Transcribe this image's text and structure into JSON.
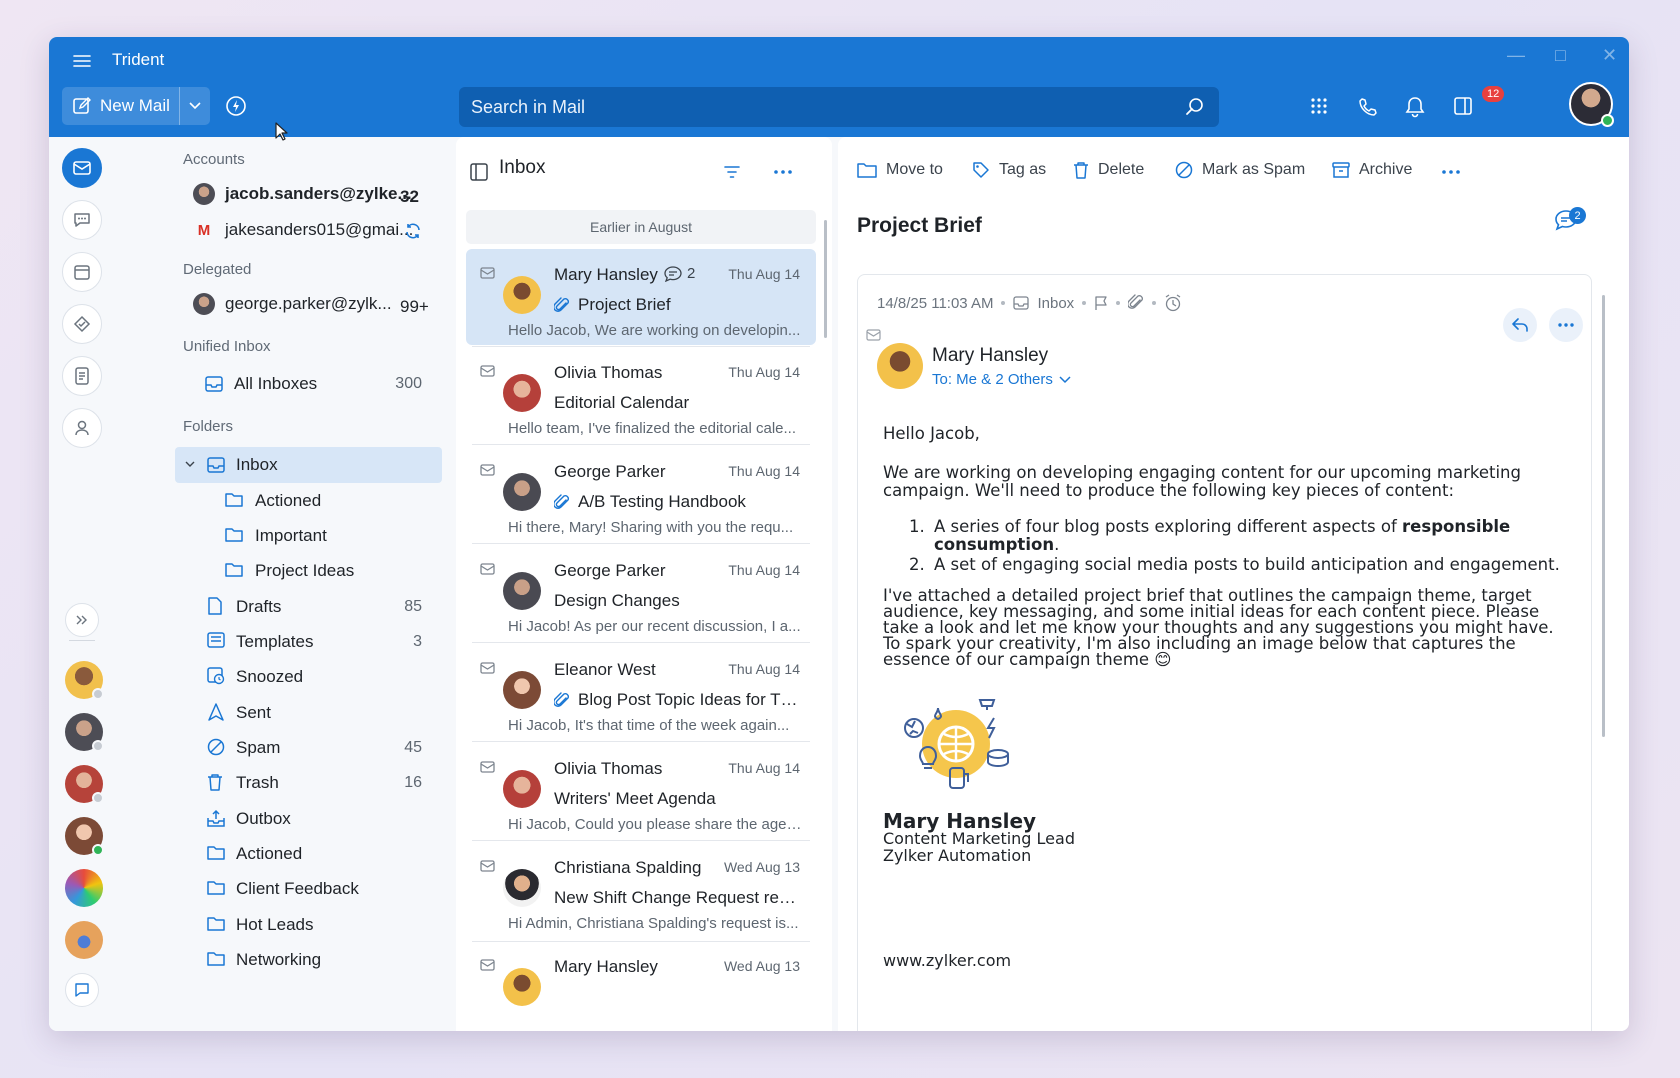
{
  "window": {
    "title": "Trident"
  },
  "header": {
    "new_mail_label": "New Mail",
    "search_placeholder": "Search in Mail",
    "notification_count": "12"
  },
  "rail": {
    "icons": [
      "mail-icon",
      "chat-icon",
      "calendar-icon",
      "tasks-icon",
      "notes-icon",
      "contacts-icon"
    ]
  },
  "folders_pane": {
    "accounts_header": "Accounts",
    "accounts": [
      {
        "name": "jacob.sanders@zylke...",
        "count": "32"
      },
      {
        "name": "jakesanders015@gmai..."
      }
    ],
    "delegated_header": "Delegated",
    "delegated": [
      {
        "name": "george.parker@zylk...",
        "count": "99+"
      }
    ],
    "unified_header": "Unified Inbox",
    "unified": {
      "label": "All Inboxes",
      "count": "300"
    },
    "folders_header": "Folders",
    "folders": [
      {
        "label": "Inbox",
        "count": ""
      },
      {
        "label": "Actioned",
        "count": ""
      },
      {
        "label": "Important",
        "count": ""
      },
      {
        "label": "Project Ideas",
        "count": ""
      },
      {
        "label": "Drafts",
        "count": "85"
      },
      {
        "label": "Templates",
        "count": "3"
      },
      {
        "label": "Snoozed",
        "count": ""
      },
      {
        "label": "Sent",
        "count": ""
      },
      {
        "label": "Spam",
        "count": "45"
      },
      {
        "label": "Trash",
        "count": "16"
      },
      {
        "label": "Outbox",
        "count": ""
      },
      {
        "label": "Actioned",
        "count": ""
      },
      {
        "label": "Client Feedback",
        "count": ""
      },
      {
        "label": "Hot Leads",
        "count": ""
      },
      {
        "label": "Networking",
        "count": ""
      }
    ]
  },
  "mail_list": {
    "title": "Inbox",
    "group_header": "Earlier in August",
    "items": [
      {
        "sender": "Mary Hansley",
        "thread_count": "2",
        "date": "Thu Aug 14",
        "subject": "Project Brief",
        "preview": "Hello Jacob, We are working on developin...",
        "attachment": true
      },
      {
        "sender": "Olivia Thomas",
        "date": "Thu Aug 14",
        "subject": "Editorial Calendar",
        "preview": "Hello team, I've finalized the editorial cale...",
        "attachment": false
      },
      {
        "sender": "George Parker",
        "date": "Thu Aug 14",
        "subject": "A/B Testing Handbook",
        "preview": "Hi there, Mary! Sharing with you the requ...",
        "attachment": true
      },
      {
        "sender": "George Parker",
        "date": "Thu Aug 14",
        "subject": "Design Changes",
        "preview": "Hi Jacob! As per our recent discussion, I a...",
        "attachment": false
      },
      {
        "sender": "Eleanor West",
        "date": "Thu Aug 14",
        "subject": "Blog Post Topic Ideas for Thi...",
        "preview": "Hi Jacob, It's that time of the week again...",
        "attachment": true
      },
      {
        "sender": "Olivia Thomas",
        "date": "Thu Aug 14",
        "subject": "Writers' Meet Agenda",
        "preview": "Hi Jacob, Could you please share the agen...",
        "attachment": false
      },
      {
        "sender": "Christiana Spalding",
        "date": "Wed Aug 13",
        "subject": "New Shift Change Request requ...",
        "preview": "Hi Admin, Christiana Spalding's request is...",
        "attachment": false
      },
      {
        "sender": "Mary Hansley",
        "date": "Wed Aug 13",
        "subject": "",
        "preview": "",
        "attachment": false
      }
    ]
  },
  "toolbar": {
    "move_to": "Move to",
    "tag_as": "Tag as",
    "delete": "Delete",
    "mark_as_spam": "Mark as Spam",
    "archive": "Archive"
  },
  "reader": {
    "subject": "Project Brief",
    "chat_count": "2",
    "timestamp": "14/8/25 11:03 AM",
    "folder": "Inbox",
    "from_name": "Mary Hansley",
    "to_line": "To: Me & 2 Others",
    "greeting": "Hello Jacob,",
    "para1": "We are working on developing engaging content for our upcoming marketing campaign. We'll need to produce the following key pieces of content:",
    "list1_pre": "A series of four blog posts exploring different aspects of ",
    "list1_bold": "responsible consumption",
    "list1_post": ".",
    "list2": "A set of engaging social media posts to build anticipation and engagement.",
    "para2": "I've attached a detailed project brief that outlines the campaign theme, target audience, key messaging, and some initial ideas for each content piece. Please take a look and let me know your thoughts and any suggestions you might have.",
    "para3": "To spark your creativity, I'm also including an image below that captures the essence of our campaign theme 😊",
    "sig_name": "Mary Hansley",
    "sig_title": "Content Marketing Lead",
    "sig_company": "Zylker Automation",
    "website": "www.zylker.com"
  },
  "colors": {
    "brand": "#1a77d4",
    "selected": "#d6e5f6",
    "badge": "#e8403e"
  }
}
